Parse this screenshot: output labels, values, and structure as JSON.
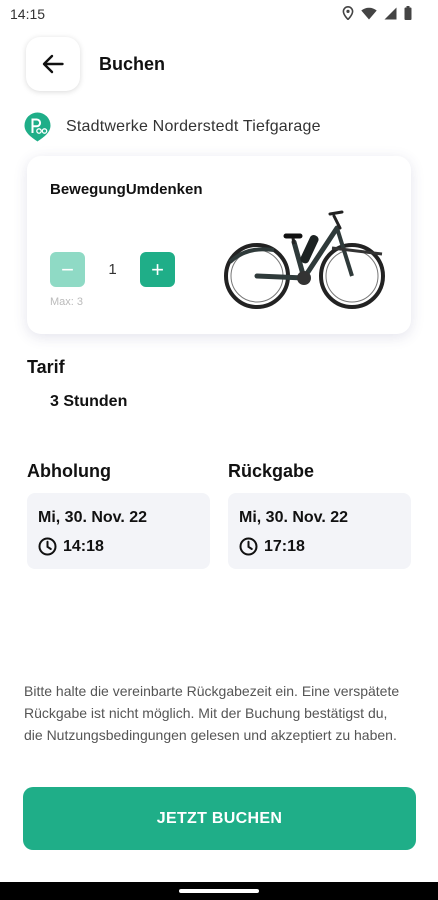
{
  "status_bar": {
    "time": "14:15",
    "icons": [
      "location-icon",
      "wifi-icon",
      "signal-icon",
      "battery-icon"
    ]
  },
  "header": {
    "title": "Buchen",
    "back_icon": "arrow-left-icon"
  },
  "location": {
    "name": "Stadtwerke Norderstedt Tiefgarage",
    "icon": "bike-station-icon"
  },
  "bike": {
    "name": "BewegungUmdenken",
    "quantity": "1",
    "minus_label": "−",
    "plus_label": "+",
    "max_label": "Max: 3"
  },
  "tarif": {
    "label": "Tarif",
    "value": "3 Stunden"
  },
  "pickup": {
    "label": "Abholung",
    "date": "Mi, 30. Nov. 22",
    "time": "14:18"
  },
  "return": {
    "label": "Rückgabe",
    "date": "Mi, 30. Nov. 22",
    "time": "17:18"
  },
  "notice": "Bitte halte die vereinbarte Rückgabezeit ein. Eine verspätete Rückgabe ist nicht möglich. Mit der Buchung bestätigst du, die Nutzungsbedingungen gelesen und akzeptiert zu haben.",
  "book_button": "JETZT BUCHEN",
  "colors": {
    "accent": "#1fae88",
    "accent_disabled": "#8fdac5",
    "box_bg": "#f3f4f8"
  }
}
